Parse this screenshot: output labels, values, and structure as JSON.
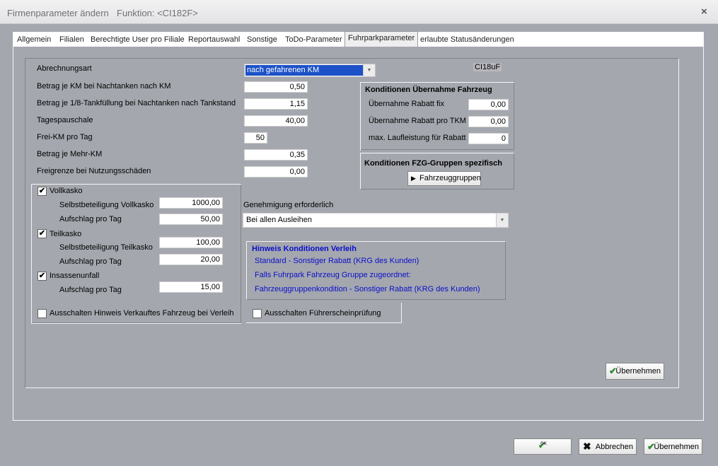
{
  "window": {
    "title": "Firmenparameter ändern",
    "function": "Funktion: <CI182F>",
    "close_label": "×"
  },
  "tabs": [
    {
      "label": "Allgemein"
    },
    {
      "label": "Filialen"
    },
    {
      "label": "Berechtigte User pro Filiale"
    },
    {
      "label": "Reportauswahl"
    },
    {
      "label": "Sonstige"
    },
    {
      "label": "ToDo-Parameter"
    },
    {
      "label": "Fuhrparkparameter"
    },
    {
      "label": "erlaubte Statusänderungen"
    }
  ],
  "active_tab": "Fuhrparkparameter",
  "code_label": "CI18uF",
  "billing": {
    "label": "Abrechnungsart",
    "value": "nach gefahrenen KM",
    "highlight_color": "#1c51c8"
  },
  "params": [
    {
      "label": "Betrag je KM bei Nachtanken nach KM",
      "value": "0,50"
    },
    {
      "label": "Betrag je 1/8-Tankfüllung bei Nachtanken nach Tankstand",
      "value": "1,15"
    },
    {
      "label": "Tagespauschale",
      "value": "40,00"
    },
    {
      "label": "Frei-KM pro Tag",
      "value": "50"
    },
    {
      "label": "Betrag je Mehr-KM",
      "value": "0,35"
    },
    {
      "label": "Freigrenze bei Nutzungsschäden",
      "value": "0,00"
    }
  ],
  "takeover": {
    "title": "Konditionen Übernahme Fahrzeug",
    "rows": [
      {
        "label": "Übernahme Rabatt fix",
        "value": "0,00"
      },
      {
        "label": "Übernahme Rabatt pro TKM",
        "value": "0,00"
      },
      {
        "label": "max. Laufleistung für Rabatt",
        "value": "0"
      }
    ]
  },
  "groups": {
    "title": "Konditionen FZG-Gruppen spezifisch",
    "button": "Fahrzeuggruppen"
  },
  "insurance": {
    "vollkasko": {
      "label": "Vollkasko",
      "checked": true,
      "self_label": "Selbstbeteiligung Vollkasko",
      "self_value": "1000,00",
      "fee_label": "Aufschlag pro Tag",
      "fee_value": "50,00"
    },
    "teilkasko": {
      "label": "Teilkasko",
      "checked": true,
      "self_label": "Selbstbeteiligung Teilkasko",
      "self_value": "100,00",
      "fee_label": "Aufschlag pro Tag",
      "fee_value": "20,00"
    },
    "insassen": {
      "label": "Insassenunfall",
      "checked": true,
      "fee_label": "Aufschlag pro Tag",
      "fee_value": "15,00"
    }
  },
  "approval": {
    "label": "Genehmigung erforderlich",
    "value": "Bei allen Ausleihen"
  },
  "hint": {
    "title": "Hinweis Konditionen Verleih",
    "lines": [
      "Standard - Sonstiger Rabatt (KRG des Kunden)",
      "Falls Fuhrpark Fahrzeug Gruppe zugeordnet:",
      "Fahrzeuggruppenkondition - Sonstiger Rabatt (KRG des Kunden)"
    ]
  },
  "options": {
    "hint_sold": {
      "label": "Ausschalten Hinweis Verkauftes Fahrzeug bei Verleih",
      "checked": false
    },
    "license_check": {
      "label": "Ausschalten Führerscheinprüfung",
      "checked": false
    }
  },
  "buttons": {
    "apply_inner": "Übernehmen",
    "ok": "OK",
    "cancel": "Abbrechen",
    "apply": "Übernehmen"
  },
  "colors": {
    "background": "#a4a7ae",
    "hint_text": "#0b10c8"
  }
}
